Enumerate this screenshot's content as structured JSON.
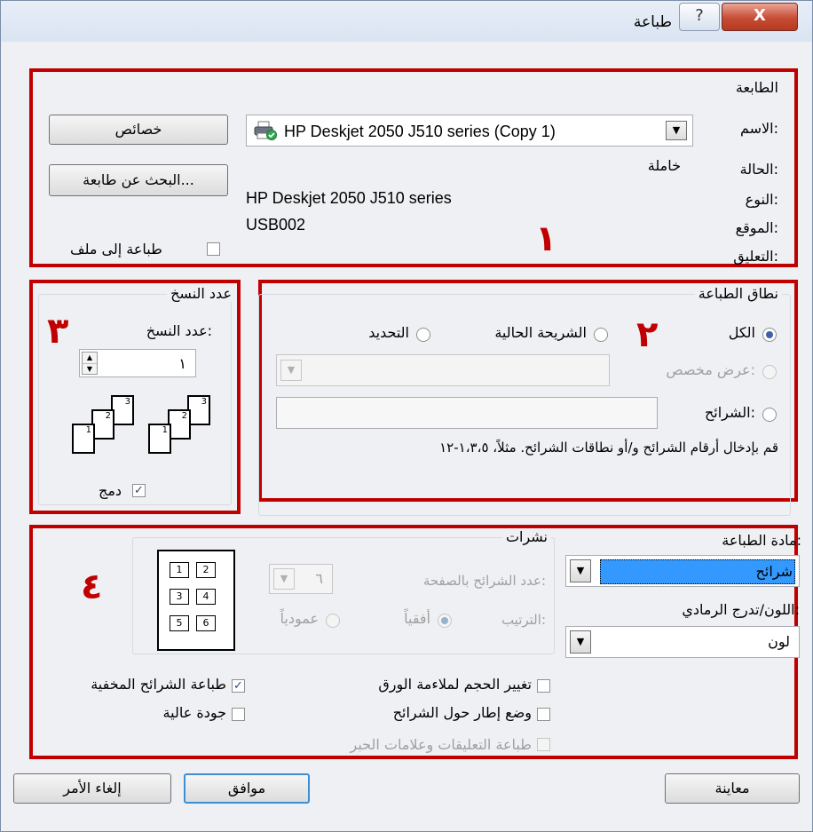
{
  "window": {
    "title": "طباعة",
    "help_glyph": "?",
    "close_glyph": "X"
  },
  "printer": {
    "group_label": "الطابعة",
    "name_label": "الاسم:",
    "name_value": "HP Deskjet 2050 J510 series (Copy 1)",
    "status_label": "الحالة:",
    "status_value": "خاملة",
    "type_label": "النوع:",
    "type_value": "HP Deskjet 2050 J510 series",
    "where_label": "الموقع:",
    "where_value": "USB002",
    "comment_label": "التعليق:",
    "properties_button": "خصائص",
    "find_button": "البحث عن طابعة...",
    "print_to_file": "طباعة إلى ملف",
    "print_to_file_checked": false
  },
  "annotations": {
    "n1": "١",
    "n2": "٢",
    "n3": "٣",
    "n4": "٤"
  },
  "range": {
    "group_label": "نطاق الطباعة",
    "all": "الكل",
    "current_slide": "الشريحة الحالية",
    "selection": "التحديد",
    "custom_show": "عرض مخصص:",
    "slides": "الشرائح:",
    "hint": "قم بإدخال أرقام الشرائح و/أو نطاقات الشرائح. مثلاً، ١،٣،٥-١٢",
    "selected": "all"
  },
  "copies": {
    "group_label": "عدد النسخ",
    "count_label": "عدد النسخ:",
    "count_value": "١",
    "collate": "دمج",
    "collate_checked": true
  },
  "print_what": {
    "label": "مادة الطباعة:",
    "value": "شرائح",
    "color_label": "اللون/تدرج الرمادي:",
    "color_value": "لون"
  },
  "handouts": {
    "group_label": "نشرات",
    "per_page_label": "عدد الشرائح بالصفحة:",
    "per_page_value": "٦",
    "order_label": "الترتيب:",
    "horizontal": "أفقياً",
    "vertical": "عمودياً",
    "preview_numbers": [
      "1",
      "2",
      "3",
      "4",
      "5",
      "6"
    ]
  },
  "options": {
    "scale_to_fit": "تغيير الحجم لملاءمة الورق",
    "frame_slides": "وضع إطار حول الشرائح",
    "print_comments": "طباعة التعليقات وعلامات الحبر",
    "print_hidden": "طباعة الشرائح المخفية",
    "high_quality": "جودة عالية",
    "print_hidden_checked": true
  },
  "footer": {
    "preview": "معاينة",
    "ok": "موافق",
    "cancel": "إلغاء الأمر"
  },
  "colors": {
    "annotation_red": "#c00000",
    "selection_blue": "#3399ff"
  }
}
